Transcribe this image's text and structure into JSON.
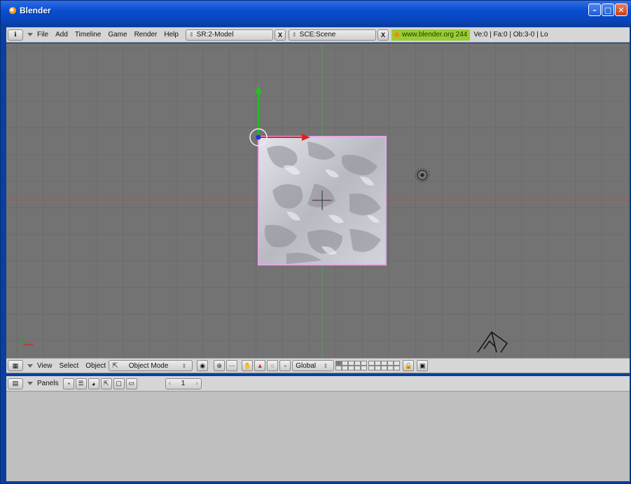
{
  "window": {
    "title": "Blender"
  },
  "top_header": {
    "menus": [
      "File",
      "Add",
      "Timeline",
      "Game",
      "Render",
      "Help"
    ],
    "screen_field": "SR:2-Model",
    "scene_field": "SCE:Scene",
    "url": "www.blender.org 244",
    "stats": "Ve:0 | Fa:0 | Ob:3-0 | Lo"
  },
  "view_header": {
    "menus": [
      "View",
      "Select",
      "Object"
    ],
    "mode": "Object Mode",
    "orientation": "Global"
  },
  "buttons_header": {
    "panels_label": "Panels",
    "frame": "1"
  },
  "icons": {
    "window_type": "info-icon",
    "view_type": "3d-view-icon",
    "buttons_type": "buttons-window-icon",
    "object_mode": "object-mode-icon",
    "camera": "camera-icon",
    "lamp": "lamp-icon"
  },
  "colors": {
    "titlebar": "#0a4fd0",
    "viewport_bg": "#737373",
    "grid": "#666666",
    "x_axis": "#b05a5a",
    "y_axis": "#4fa84f",
    "selection": "#e6a8e6",
    "url_badge": "#9acd32"
  }
}
